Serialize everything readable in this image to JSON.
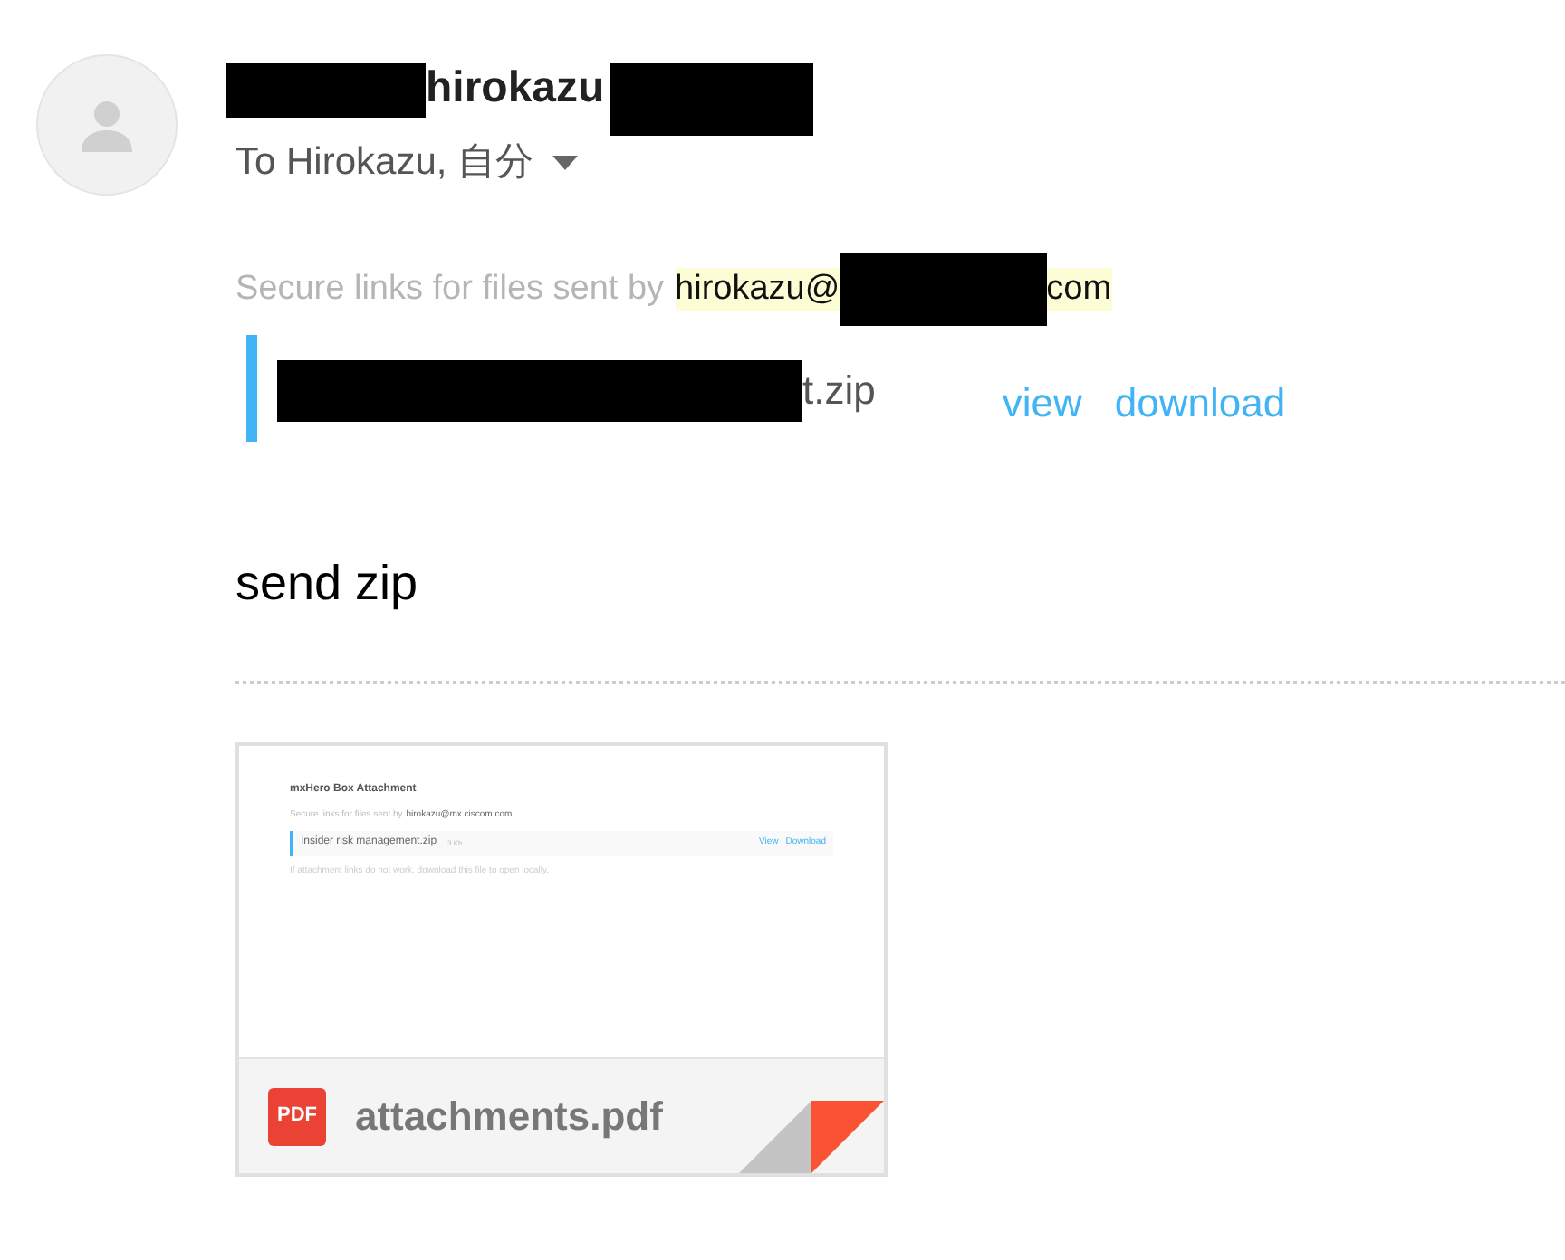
{
  "sender": {
    "name": "hirokazu",
    "recipients": "To Hirokazu, 自分"
  },
  "message": {
    "intro": "Secure links for files sent by",
    "email_start": "hirokazu@",
    "email_end": "com",
    "file": {
      "name": "t.zip",
      "links": [
        "view",
        "download"
      ]
    },
    "body": "send zip"
  },
  "attachment": {
    "preview": {
      "title": "mxHero Box Attachment",
      "intro": "Secure links for files sent by",
      "email": "hirokazu@mx.ciscom.com",
      "file_name": "Insider risk management.zip",
      "file_size": "3 Kb",
      "links": [
        "View",
        "Download"
      ],
      "note": "If attachment links do not work, download this file to open locally."
    },
    "icon_label": "PDF",
    "file_name": "attachments.pdf"
  }
}
